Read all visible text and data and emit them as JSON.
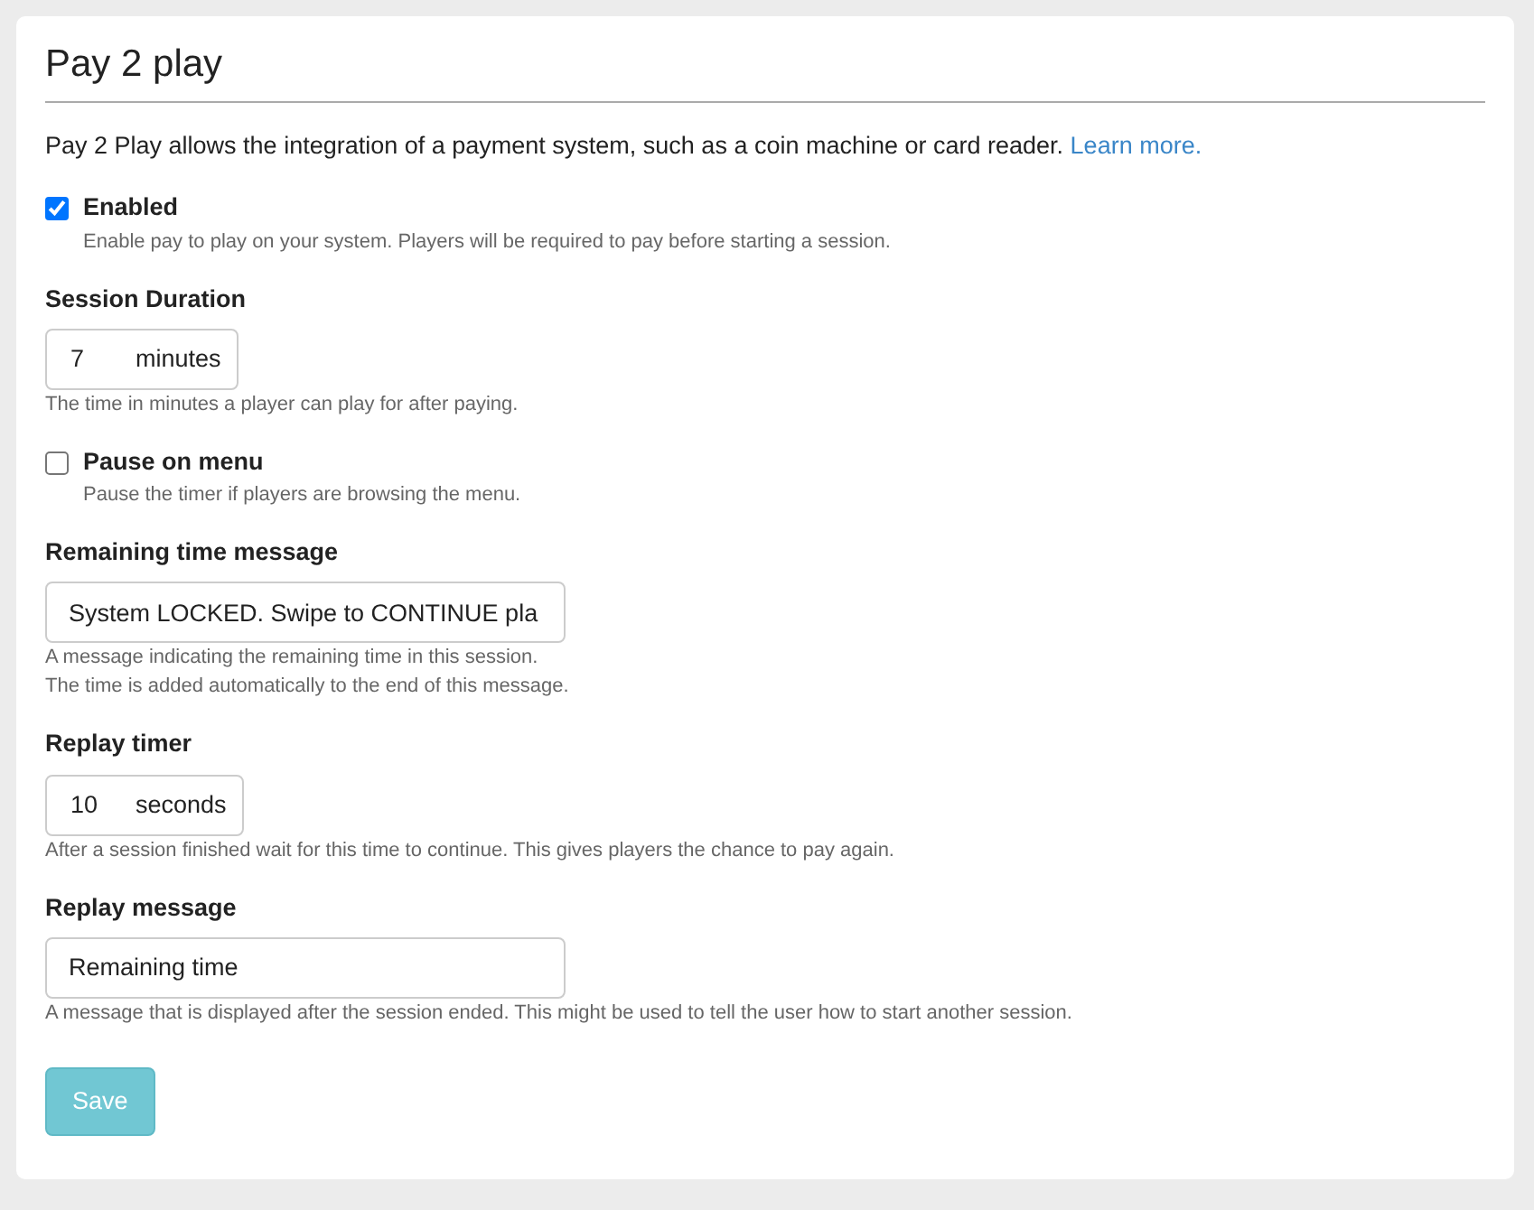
{
  "title": "Pay 2 play",
  "intro": {
    "text": "Pay 2 Play allows the integration of a payment system, such as a coin machine or card reader.",
    "link": "Learn more."
  },
  "fields": [
    {
      "kind": "checkbox",
      "label": "Enabled",
      "checked": true,
      "help": [
        "Enable pay to play on your system. Players will be required to pay before starting a session."
      ]
    },
    {
      "kind": "unit",
      "label": "Session Duration",
      "value": "7",
      "unit": "minutes",
      "help": [
        "The time in minutes a player can play for after paying."
      ]
    },
    {
      "kind": "checkbox",
      "label": "Pause on menu",
      "checked": false,
      "help": [
        "Pause the timer if players are browsing the menu."
      ]
    },
    {
      "kind": "text",
      "label": "Remaining time message",
      "value": "System LOCKED. Swipe to CONTINUE pla",
      "help": [
        "A message indicating the remaining time in this session.",
        "The time is added automatically to the end of this message."
      ]
    },
    {
      "kind": "unit",
      "label": "Replay timer",
      "value": "10",
      "unit": "seconds",
      "help": [
        "After a session finished wait for this time to continue. This gives players the chance to pay again."
      ]
    },
    {
      "kind": "text",
      "label": "Replay message",
      "value": "Remaining time",
      "help": [
        "A message that is displayed after the session ended. This might be used to tell the user how to start another session."
      ]
    }
  ],
  "save": {
    "label": "Save",
    "disabled": true
  }
}
